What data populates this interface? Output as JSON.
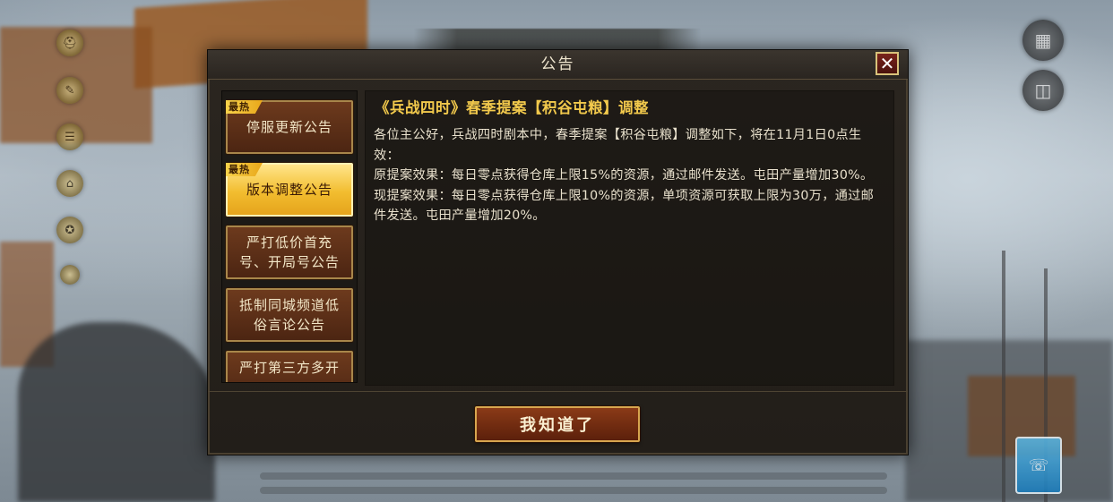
{
  "modal": {
    "title": "公告",
    "confirm_label": "我知道了"
  },
  "tabs": [
    {
      "label": "停服更新公告",
      "badge": "最热",
      "active": false
    },
    {
      "label": "版本调整公告",
      "badge": "最热",
      "active": true
    },
    {
      "label": "严打低价首充号、开局号公告",
      "badge": "",
      "active": false
    },
    {
      "label": "抵制同城频道低俗言论公告",
      "badge": "",
      "active": false
    },
    {
      "label": "严打第三方多开",
      "badge": "",
      "active": false
    }
  ],
  "announcement": {
    "title": "《兵战四时》春季提案【积谷屯粮】调整",
    "paragraphs": [
      "各位主公好，兵战四时剧本中，春季提案【积谷屯粮】调整如下，将在11月1日0点生效：",
      "原提案效果：每日零点获得仓库上限15%的资源，通过邮件发送。屯田产量增加30%。",
      "现提案效果：每日零点获得仓库上限10%的资源，单项资源可获取上限为30万，通过邮件发送。屯田产量增加20%。"
    ]
  },
  "icons": {
    "close": "close-icon",
    "side": [
      "helmet-icon",
      "scroll-icon",
      "list-icon",
      "castle-icon",
      "medal-icon",
      "dot-icon"
    ],
    "corner": [
      "grid-icon",
      "map-icon"
    ],
    "support": "customer-service-icon"
  },
  "colors": {
    "title_gold": "#f2c94c",
    "active_tab": "#f2bd2f",
    "tab_brown": "#6d3a1d"
  }
}
